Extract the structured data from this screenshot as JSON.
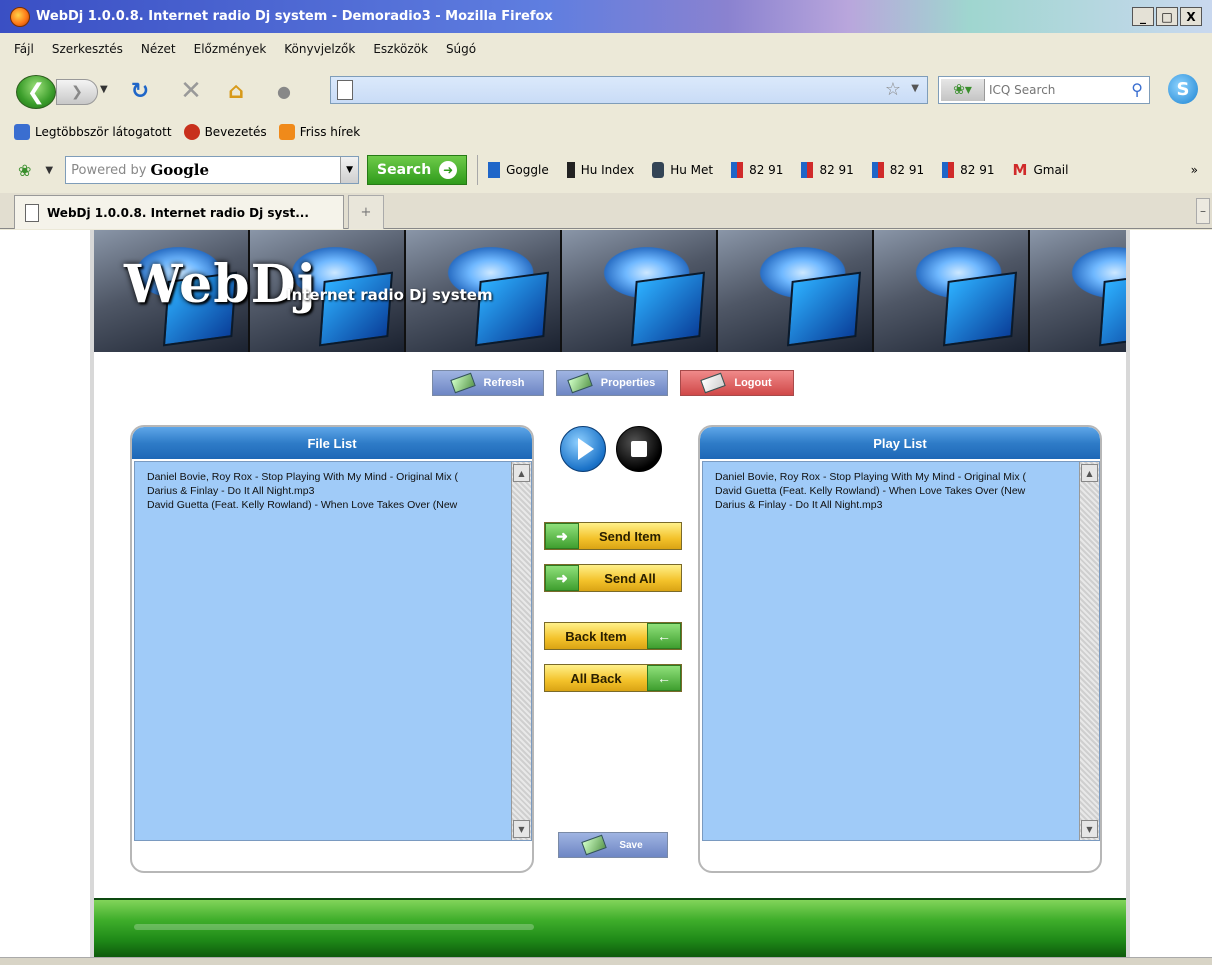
{
  "window": {
    "title": "WebDj 1.0.0.8. Internet radio Dj system - Demoradio3 - Mozilla Firefox",
    "controls": [
      "_",
      "□",
      "X"
    ]
  },
  "menu": {
    "items": [
      "Fájl",
      "Szerkesztés",
      "Nézet",
      "Előzmények",
      "Könyvjelzők",
      "Eszközök",
      "Súgó"
    ]
  },
  "nav": {
    "url": "",
    "search_placeholder": "ICQ Search"
  },
  "bookmarks": {
    "items": [
      {
        "label": "Legtöbbször látogatott",
        "color": "#3a6ed0"
      },
      {
        "label": "Bevezetés",
        "color": "#c8301c"
      },
      {
        "label": "Friss hírek",
        "color": "#f08a1a"
      }
    ]
  },
  "google_toolbar": {
    "placeholder": "Powered by",
    "brand": "Google",
    "search_label": "Search",
    "links": [
      {
        "label": "Goggle",
        "color": "#1f66c8"
      },
      {
        "label": "Hu Index",
        "color": "#e07a1a"
      },
      {
        "label": "Hu Met",
        "color": "#345"
      },
      {
        "label": "82 91",
        "color": "#d02a2a"
      },
      {
        "label": "82 91",
        "color": "#d02a2a"
      },
      {
        "label": "82 91",
        "color": "#d02a2a"
      },
      {
        "label": "82 91",
        "color": "#d02a2a"
      },
      {
        "label": "Gmail",
        "color": "#d02a2a"
      }
    ],
    "more": "»"
  },
  "tab": {
    "label": "WebDj 1.0.0.8. Internet radio Dj syst...",
    "new_tab": "+"
  },
  "banner": {
    "logo": "WebDj",
    "subtitle": "Internet radio Dj system"
  },
  "top_buttons": {
    "refresh": "Refresh",
    "properties": "Properties",
    "logout": "Logout"
  },
  "file_list": {
    "title": "File List",
    "items": [
      "Daniel Bovie, Roy Rox - Stop Playing With My Mind - Original Mix (",
      "Darius & Finlay - Do It All Night.mp3",
      "David Guetta (Feat. Kelly Rowland) - When Love Takes Over (New"
    ]
  },
  "play_list": {
    "title": "Play List",
    "items": [
      "Daniel Bovie, Roy Rox - Stop Playing With My Mind - Original Mix (",
      "David Guetta (Feat. Kelly Rowland) - When Love Takes Over (New",
      "Darius & Finlay - Do It All Night.mp3"
    ]
  },
  "transfer": {
    "send_item": "Send Item",
    "send_all": "Send All",
    "back_item": "Back Item",
    "all_back": "All Back"
  },
  "save_label": "Save"
}
